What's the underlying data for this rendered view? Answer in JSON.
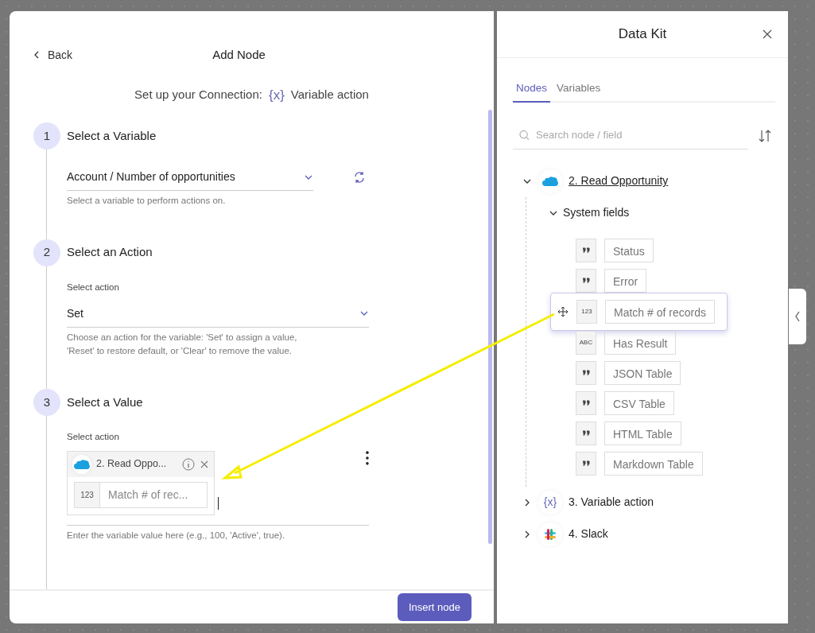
{
  "editor": {
    "back": "Back",
    "title": "Add Node",
    "subtitle": {
      "prefix": "Set up your Connection:",
      "icon": "{x}",
      "name": "Variable action"
    },
    "steps": [
      {
        "number": "1",
        "title": "Select a Variable",
        "kind": "select",
        "value": "Account / Number of opportunities",
        "refresh": true,
        "help": "Select a variable to perform actions on."
      },
      {
        "number": "2",
        "title": "Select an Action",
        "kind": "select",
        "label": "Select action",
        "value": "Set",
        "help": "Choose an action for the variable: 'Set' to assign a value, 'Reset' to restore default, or 'Clear' to remove the value."
      },
      {
        "number": "3",
        "title": "Select a Value",
        "kind": "value",
        "label": "Select action",
        "chip": {
          "node": "2. Read Oppo...",
          "badge": "123",
          "field": "Match # of rec..."
        },
        "help": "Enter the variable value here (e.g., 100, 'Active', true)."
      }
    ],
    "button": "Insert node"
  },
  "data_kit": {
    "title": "Data Kit",
    "tabs": [
      {
        "label": "Nodes",
        "selected": true
      },
      {
        "label": "Variables",
        "selected": false
      }
    ],
    "search": {
      "placeholder": "Search node / field"
    },
    "nodes": [
      {
        "title": "2. Read Opportunity",
        "kind": "cloud",
        "expanded": true,
        "children": [
          {
            "title": "System fields",
            "expanded": true,
            "children": [
              {
                "kind": "quote",
                "label": "Status",
                "dragging": false
              },
              {
                "kind": "quote",
                "label": "Error",
                "dragging": false
              },
              {
                "kind": "badge",
                "badge": "123",
                "label": "Match # of records",
                "dragging": true
              },
              {
                "kind": "badge",
                "badge": "ABC",
                "label": "Has Result",
                "dragging": false
              },
              {
                "kind": "quote",
                "label": "JSON Table",
                "dragging": false
              },
              {
                "kind": "quote",
                "label": "CSV Table",
                "dragging": false
              },
              {
                "kind": "quote",
                "label": "HTML Table",
                "dragging": false
              },
              {
                "kind": "quote",
                "label": "Markdown Table",
                "dragging": false
              }
            ]
          }
        ]
      },
      {
        "title": "3. Variable action",
        "kind": "braces",
        "logo_text": "{x}",
        "expanded": false
      },
      {
        "title": "4. Slack",
        "kind": "hash",
        "expanded": false
      }
    ]
  }
}
